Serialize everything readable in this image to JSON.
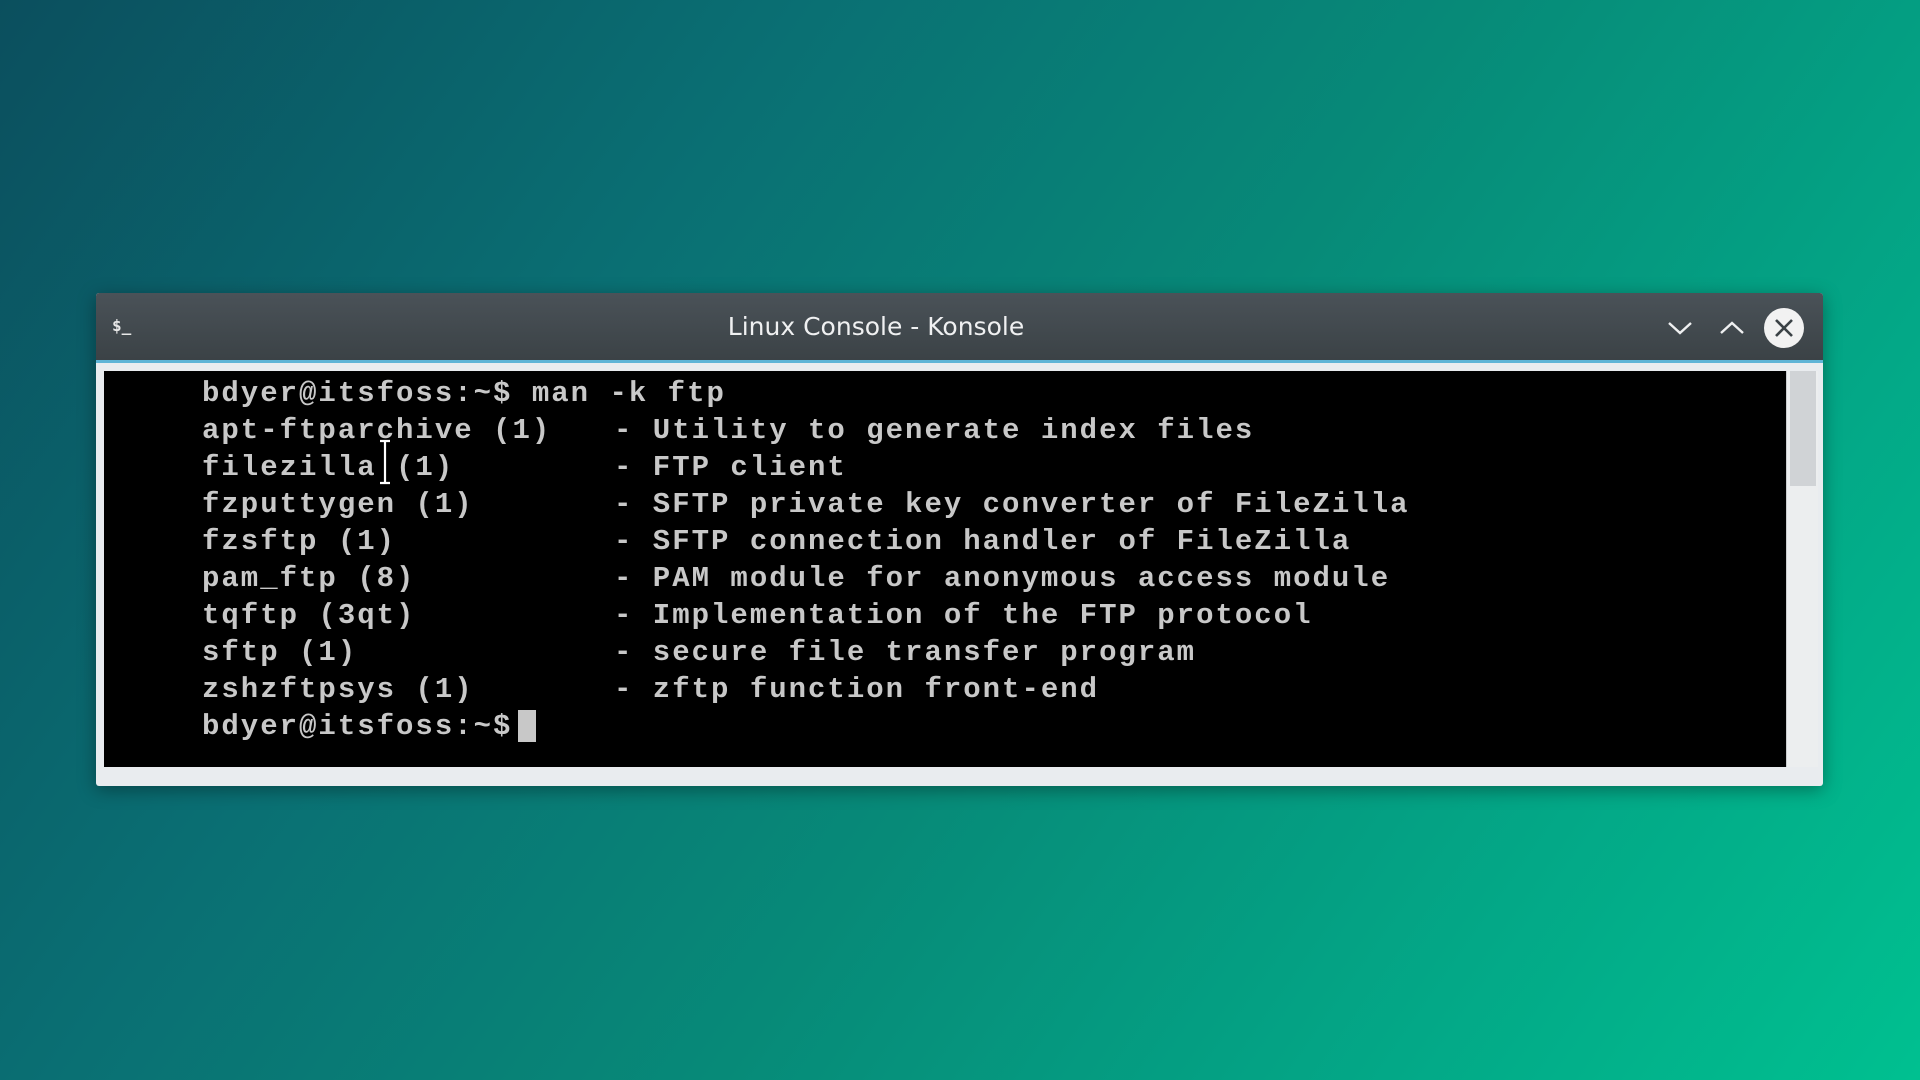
{
  "window": {
    "title": "Linux Console - Konsole",
    "app_icon_glyph": "$_",
    "app_icon": "terminal-icon",
    "controls": {
      "minimize_icon": "chevron-down-icon",
      "maximize_icon": "chevron-up-icon",
      "close_icon": "close-icon"
    }
  },
  "terminal": {
    "command_line": "bdyer@itsfoss:~$ man -k ftp",
    "results": [
      {
        "name": "apt-ftparchive (1)",
        "desc": "- Utility to generate index files"
      },
      {
        "name": "filezilla (1)",
        "desc": "- FTP client"
      },
      {
        "name": "fzputtygen (1)",
        "desc": "- SFTP private key converter of FileZilla"
      },
      {
        "name": "fzsftp (1)",
        "desc": "- SFTP connection handler of FileZilla"
      },
      {
        "name": "pam_ftp (8)",
        "desc": "- PAM module for anonymous access module"
      },
      {
        "name": "tqftp (3qt)",
        "desc": "- Implementation of the FTP protocol"
      },
      {
        "name": "sftp (1)",
        "desc": "- secure file transfer program"
      },
      {
        "name": "zshzftpsys (1)",
        "desc": "- zftp function front-end"
      }
    ],
    "prompt": "bdyer@itsfoss:~$"
  },
  "colors": {
    "terminal_bg": "#000000",
    "terminal_fg": "#c8c8c8",
    "titlebar_bg": "#3f464b",
    "accent": "#5fb4d6"
  }
}
